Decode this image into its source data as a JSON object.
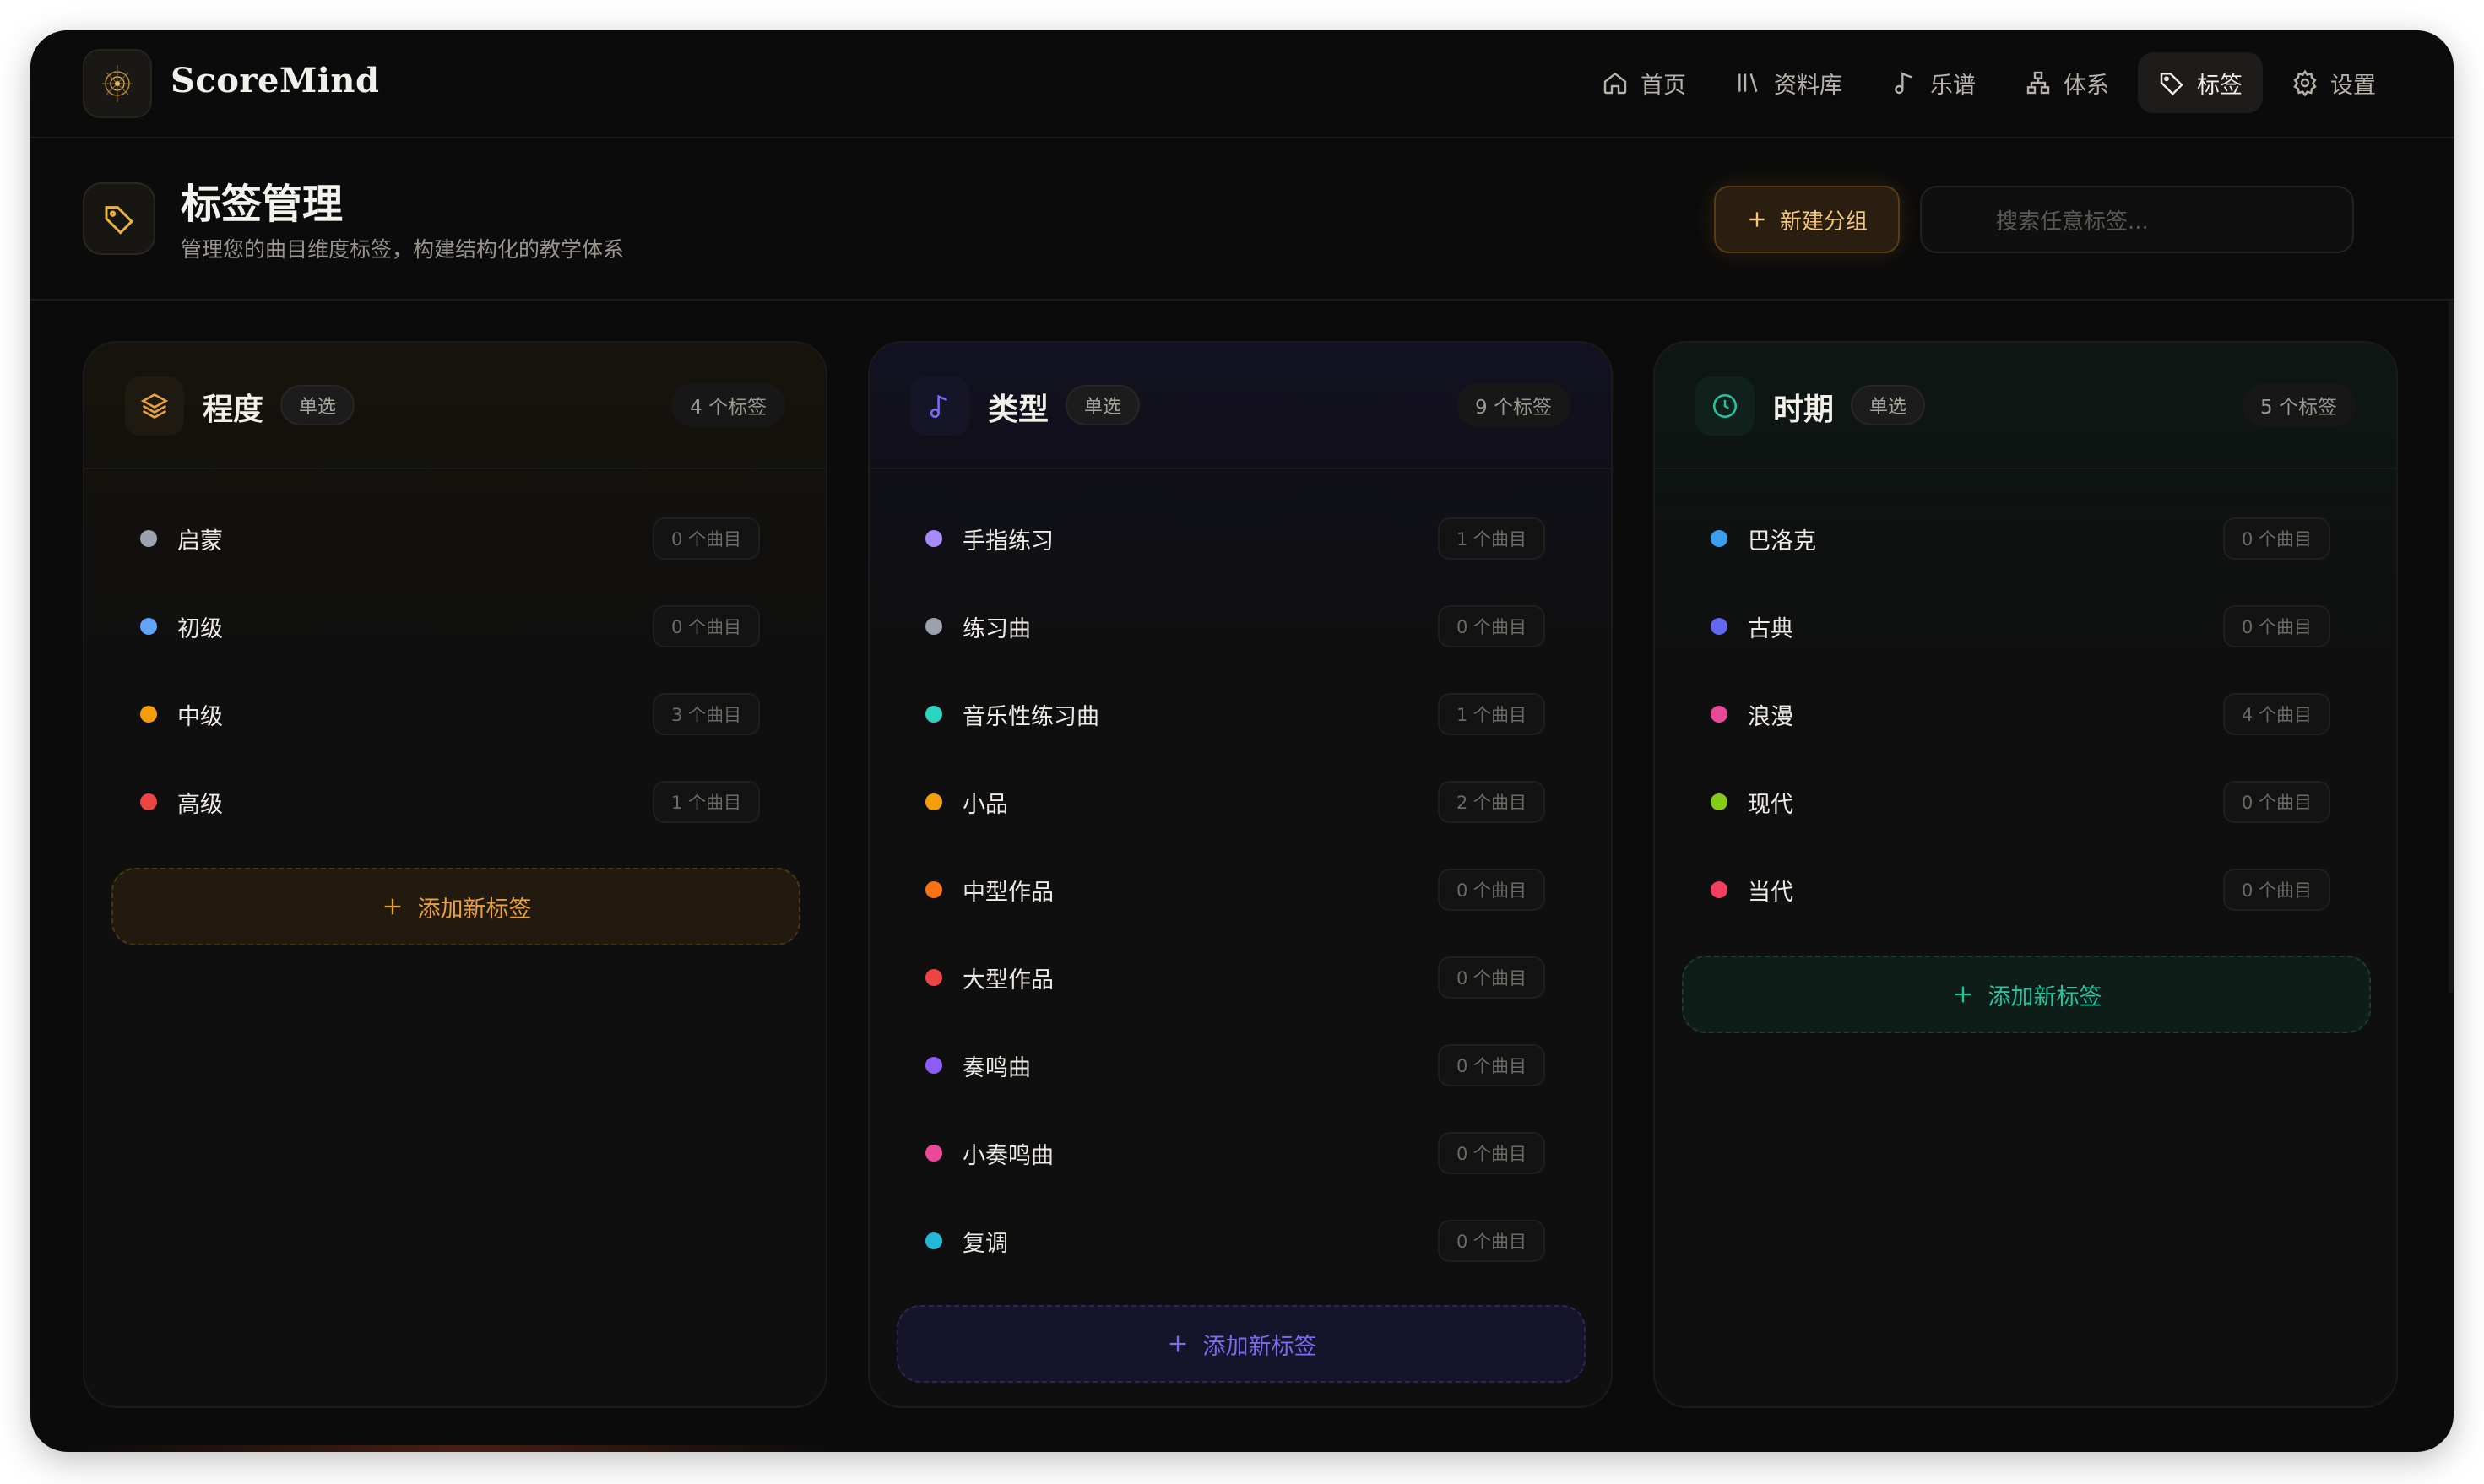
{
  "app": {
    "name": "ScoreMind"
  },
  "nav": {
    "items": [
      {
        "label": "首页",
        "icon": "home-icon"
      },
      {
        "label": "资料库",
        "icon": "library-icon"
      },
      {
        "label": "乐谱",
        "icon": "music-note-icon"
      },
      {
        "label": "体系",
        "icon": "hierarchy-icon"
      },
      {
        "label": "标签",
        "icon": "tag-icon",
        "active": true
      },
      {
        "label": "设置",
        "icon": "gear-icon"
      }
    ]
  },
  "page": {
    "title": "标签管理",
    "subtitle": "管理您的曲目维度标签，构建结构化的教学体系",
    "new_group_label": "新建分组",
    "search_placeholder": "搜索任意标签..."
  },
  "groups": [
    {
      "title": "程度",
      "mode": "单选",
      "count": "4 个标签",
      "icon": "layers-icon",
      "accent": "#e9a23b",
      "add_label": "添加新标签",
      "tags": [
        {
          "label": "启蒙",
          "count": "0 个曲目",
          "color": "#9ca3af"
        },
        {
          "label": "初级",
          "count": "0 个曲目",
          "color": "#60a5fa"
        },
        {
          "label": "中级",
          "count": "3 个曲目",
          "color": "#f59e0b"
        },
        {
          "label": "高级",
          "count": "1 个曲目",
          "color": "#ef4444"
        }
      ]
    },
    {
      "title": "类型",
      "mode": "单选",
      "count": "9 个标签",
      "icon": "music-note-icon",
      "accent": "#7c6cf0",
      "add_label": "添加新标签",
      "tags": [
        {
          "label": "手指练习",
          "count": "1 个曲目",
          "color": "#a78bfa"
        },
        {
          "label": "练习曲",
          "count": "0 个曲目",
          "color": "#9ca3af"
        },
        {
          "label": "音乐性练习曲",
          "count": "1 个曲目",
          "color": "#2dd4bf"
        },
        {
          "label": "小品",
          "count": "2 个曲目",
          "color": "#f59e0b"
        },
        {
          "label": "中型作品",
          "count": "0 个曲目",
          "color": "#f97316"
        },
        {
          "label": "大型作品",
          "count": "0 个曲目",
          "color": "#ef4444"
        },
        {
          "label": "奏鸣曲",
          "count": "0 个曲目",
          "color": "#8b5cf6"
        },
        {
          "label": "小奏鸣曲",
          "count": "0 个曲目",
          "color": "#ec4899"
        },
        {
          "label": "复调",
          "count": "0 个曲目",
          "color": "#22b8d8"
        }
      ]
    },
    {
      "title": "时期",
      "mode": "单选",
      "count": "5 个标签",
      "icon": "clock-icon",
      "accent": "#22c5a0",
      "add_label": "添加新标签",
      "tags": [
        {
          "label": "巴洛克",
          "count": "0 个曲目",
          "color": "#3b9ff0"
        },
        {
          "label": "古典",
          "count": "0 个曲目",
          "color": "#6366f1"
        },
        {
          "label": "浪漫",
          "count": "4 个曲目",
          "color": "#ec4899"
        },
        {
          "label": "现代",
          "count": "0 个曲目",
          "color": "#84cc16"
        },
        {
          "label": "当代",
          "count": "0 个曲目",
          "color": "#f43f5e"
        }
      ]
    }
  ]
}
